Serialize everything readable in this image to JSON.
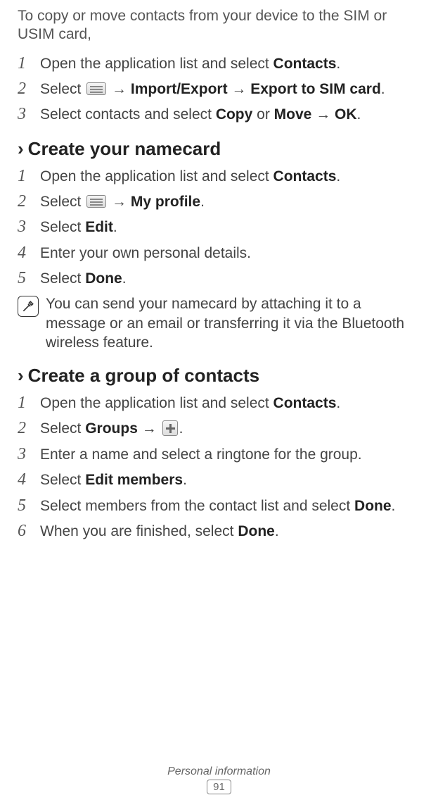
{
  "intro": "To copy or move contacts from your device to the SIM or USIM card,",
  "sec0": {
    "steps": [
      {
        "num": "1",
        "parts": [
          "Open the application list and select ",
          {
            "b": "Contacts"
          },
          "."
        ]
      },
      {
        "num": "2",
        "parts": [
          "Select ",
          {
            "icon": "menu"
          },
          " ",
          {
            "arrow": "→"
          },
          " ",
          {
            "b": "Import/Export"
          },
          " ",
          {
            "arrow": "→"
          },
          " ",
          {
            "b": "Export to SIM card"
          },
          "."
        ]
      },
      {
        "num": "3",
        "parts": [
          "Select contacts and select ",
          {
            "b": "Copy"
          },
          " or ",
          {
            "b": "Move"
          },
          " ",
          {
            "arrow": "→"
          },
          " ",
          {
            "b": "OK"
          },
          "."
        ]
      }
    ]
  },
  "sec1": {
    "heading": "Create your namecard",
    "steps": [
      {
        "num": "1",
        "parts": [
          "Open the application list and select ",
          {
            "b": "Contacts"
          },
          "."
        ]
      },
      {
        "num": "2",
        "parts": [
          "Select ",
          {
            "icon": "menu"
          },
          " ",
          {
            "arrow": "→"
          },
          " ",
          {
            "b": "My profile"
          },
          "."
        ]
      },
      {
        "num": "3",
        "parts": [
          "Select ",
          {
            "b": "Edit"
          },
          "."
        ]
      },
      {
        "num": "4",
        "parts": [
          "Enter your own personal details."
        ]
      },
      {
        "num": "5",
        "parts": [
          "Select ",
          {
            "b": "Done"
          },
          "."
        ]
      }
    ],
    "note": "You can send your namecard by attaching it to a message or an email or transferring it via the Bluetooth wireless feature."
  },
  "sec2": {
    "heading": "Create a group of contacts",
    "steps": [
      {
        "num": "1",
        "parts": [
          "Open the application list and select ",
          {
            "b": "Contacts"
          },
          "."
        ]
      },
      {
        "num": "2",
        "parts": [
          "Select ",
          {
            "b": "Groups"
          },
          " ",
          {
            "arrow": "→"
          },
          " ",
          {
            "icon": "plus"
          },
          "."
        ]
      },
      {
        "num": "3",
        "parts": [
          "Enter a name and select a ringtone for the group."
        ]
      },
      {
        "num": "4",
        "parts": [
          "Select ",
          {
            "b": "Edit members"
          },
          "."
        ]
      },
      {
        "num": "5",
        "parts": [
          "Select members from the contact list and select ",
          {
            "b": "Done"
          },
          "."
        ]
      },
      {
        "num": "6",
        "parts": [
          "When you are finished, select ",
          {
            "b": "Done"
          },
          "."
        ]
      }
    ]
  },
  "footer": {
    "section": "Personal information",
    "page": "91"
  }
}
